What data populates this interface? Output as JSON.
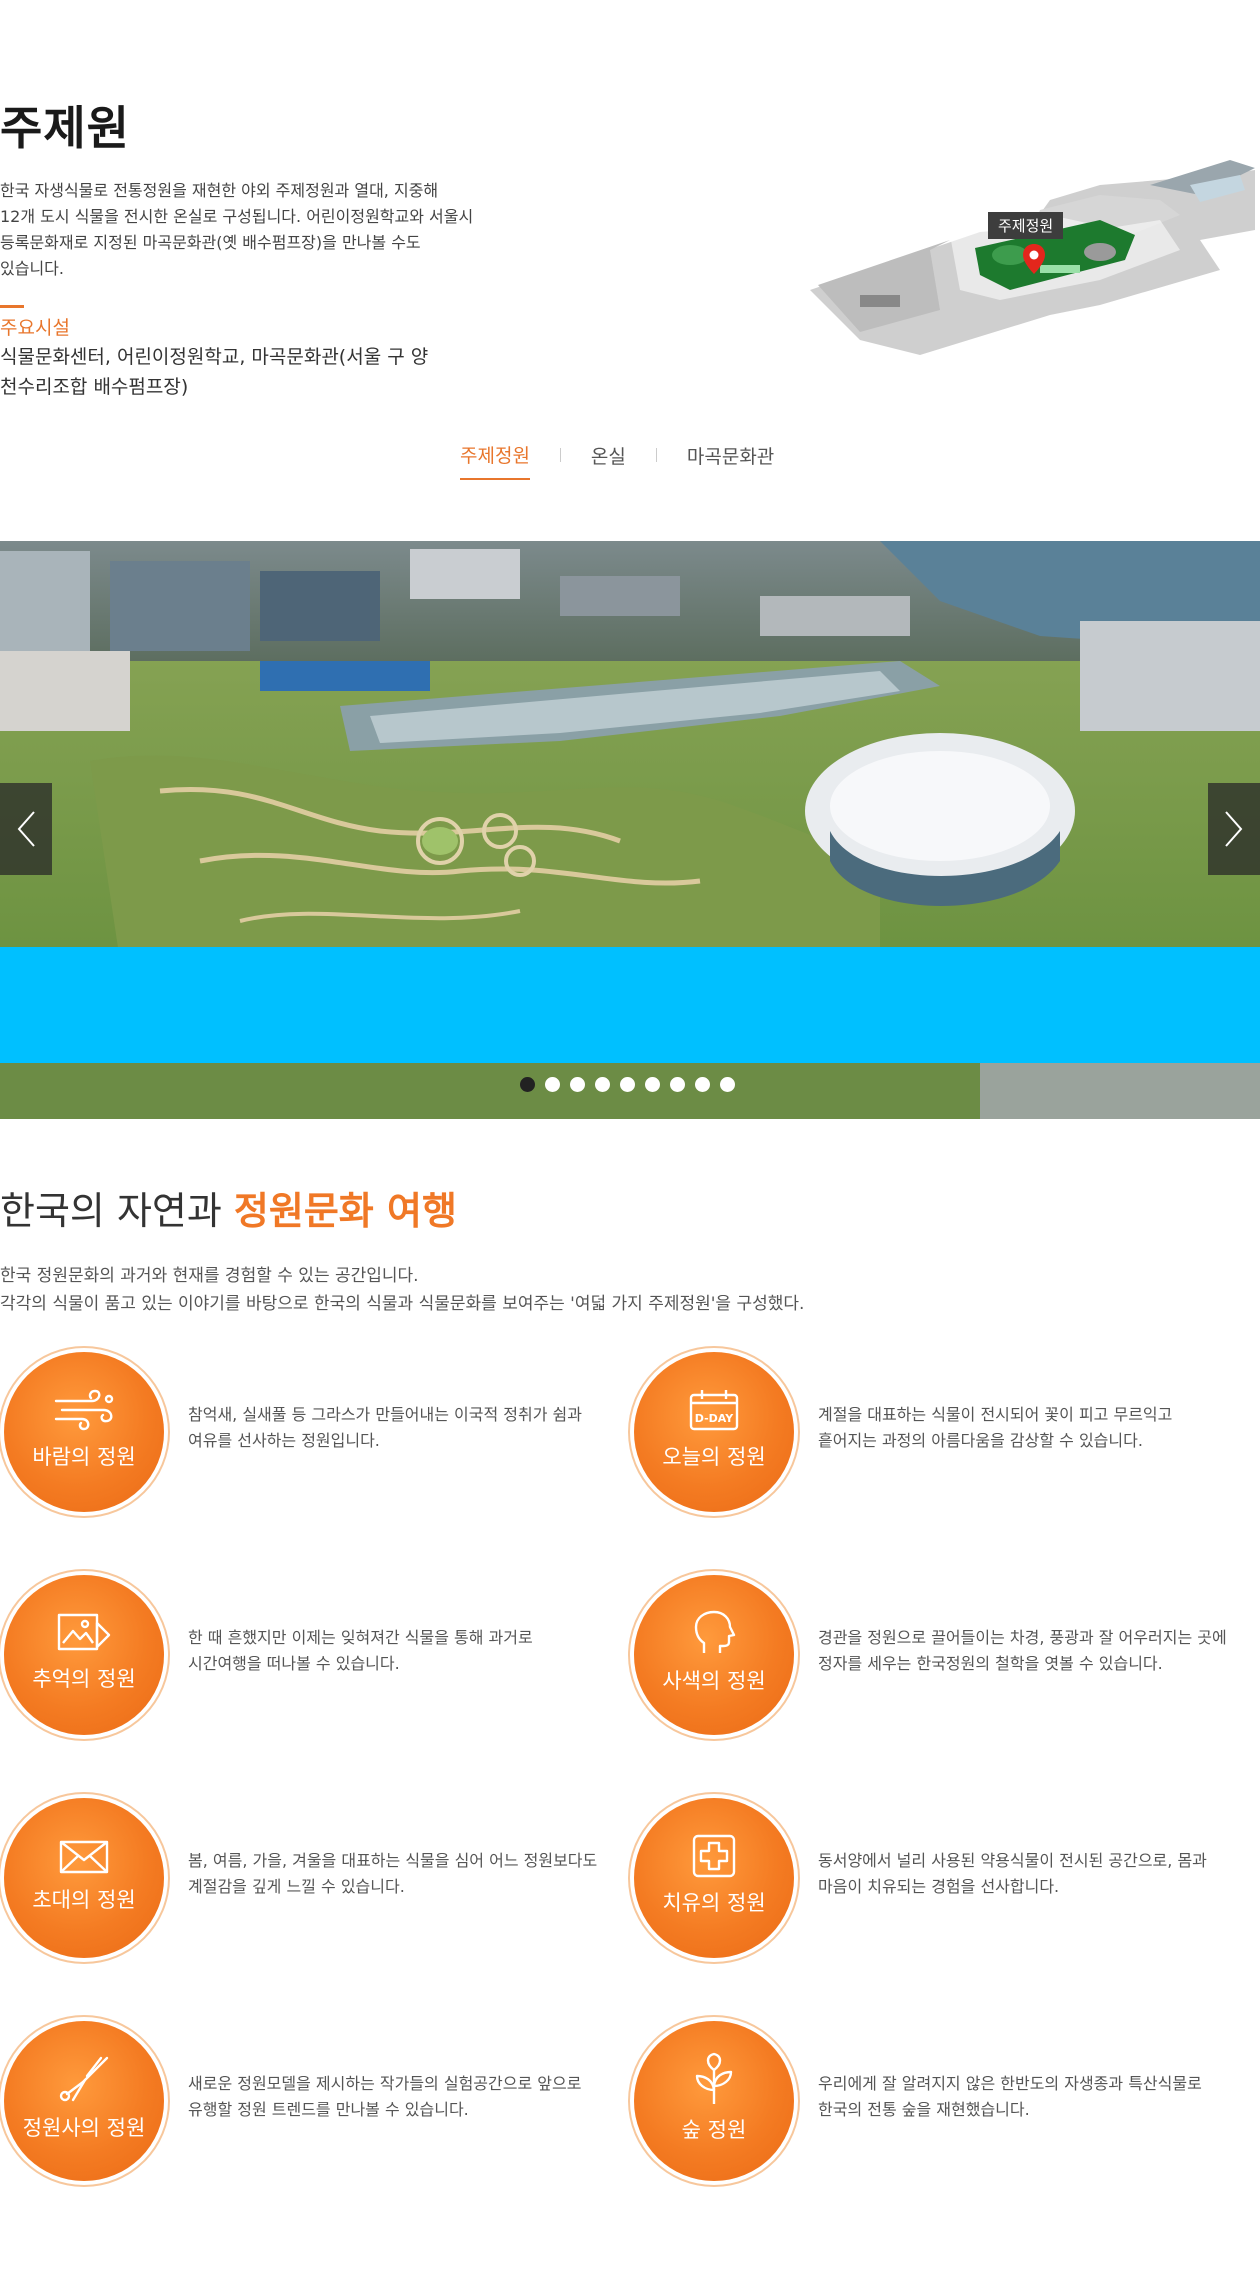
{
  "header": {
    "title": "주제원",
    "intro": [
      "한국 자생식물로 전통정원을 재현한 야외 주제정원과 열대, 지중해",
      "12개 도시 식물을 전시한 온실로 구성됩니다. 어린이정원학교와 서울시",
      "등록문화재로 지정된 마곡문화관(옛 배수펌프장)을 만나볼 수도",
      "있습니다."
    ],
    "facilities_title": "주요시설",
    "facilities_text": "식물문화센터, 어린이정원학교, 마곡문화관(서울 구 양천수리조합 배수펌프장)"
  },
  "map": {
    "label": "주제정원",
    "pin_icon": "map-pin-icon"
  },
  "tabs": [
    {
      "label": "주제정원",
      "active": true
    },
    {
      "label": "온실",
      "active": false
    },
    {
      "label": "마곡문화관",
      "active": false
    }
  ],
  "slider": {
    "prev_icon": "chevron-left-icon",
    "next_icon": "chevron-right-icon",
    "dot_count": 9,
    "active_dot": 0,
    "band_color": "#00c0ff"
  },
  "section2": {
    "title_plain": "한국의 자연과 ",
    "title_highlight": "정원문화 여행",
    "desc": [
      "한국 정원문화의 과거와 현재를 경험할 수 있는 공간입니다.",
      "각각의 식물이 품고 있는 이야기를 바탕으로 한국의 식물과 식물문화를 보여주는 '여덟 가지 주제정원'을 구성했다."
    ]
  },
  "gardens": [
    {
      "name": "바람의 정원",
      "icon": "wind-icon",
      "desc": [
        "참억새, 실새풀 등 그라스가 만들어내는 이국적 정취가 쉼과",
        "여유를 선사하는 정원입니다."
      ]
    },
    {
      "name": "오늘의 정원",
      "icon": "calendar-dday-icon",
      "desc": [
        "계절을 대표하는 식물이 전시되어 꽃이 피고 무르익고",
        "흩어지는 과정의 아름다움을 감상할 수 있습니다."
      ]
    },
    {
      "name": "추억의 정원",
      "icon": "photo-icon",
      "desc": [
        "한 때 흔했지만 이제는 잊혀져간 식물을 통해 과거로",
        "시간여행을 떠나볼 수 있습니다."
      ]
    },
    {
      "name": "사색의 정원",
      "icon": "head-icon",
      "desc": [
        "경관을 정원으로 끌어들이는 차경, 풍광과 잘 어우러지는 곳에",
        "정자를 세우는 한국정원의 철학을 엿볼 수 있습니다."
      ]
    },
    {
      "name": "초대의 정원",
      "icon": "envelope-icon",
      "desc": [
        "봄, 여름, 가을, 겨울을 대표하는 식물을 심어 어느 정원보다도",
        "계절감을 깊게 느낄 수 있습니다."
      ]
    },
    {
      "name": "치유의 정원",
      "icon": "medical-cross-icon",
      "desc": [
        "동서양에서 널리 사용된 약용식물이 전시된 공간으로, 몸과",
        "마음이 치유되는 경험을 선사합니다."
      ]
    },
    {
      "name": "정원사의 정원",
      "icon": "pruning-shears-icon",
      "desc": [
        "새로운 정원모델을 제시하는 작가들의 실험공간으로 앞으로",
        "유행할 정원 트렌드를 만나볼 수 있습니다."
      ]
    },
    {
      "name": "숲 정원",
      "icon": "sprout-icon",
      "desc": [
        "우리에게 잘 알려지지 않은 한반도의 자생종과 특산식물로",
        "한국의 전통 숲을 재현했습니다."
      ]
    }
  ]
}
